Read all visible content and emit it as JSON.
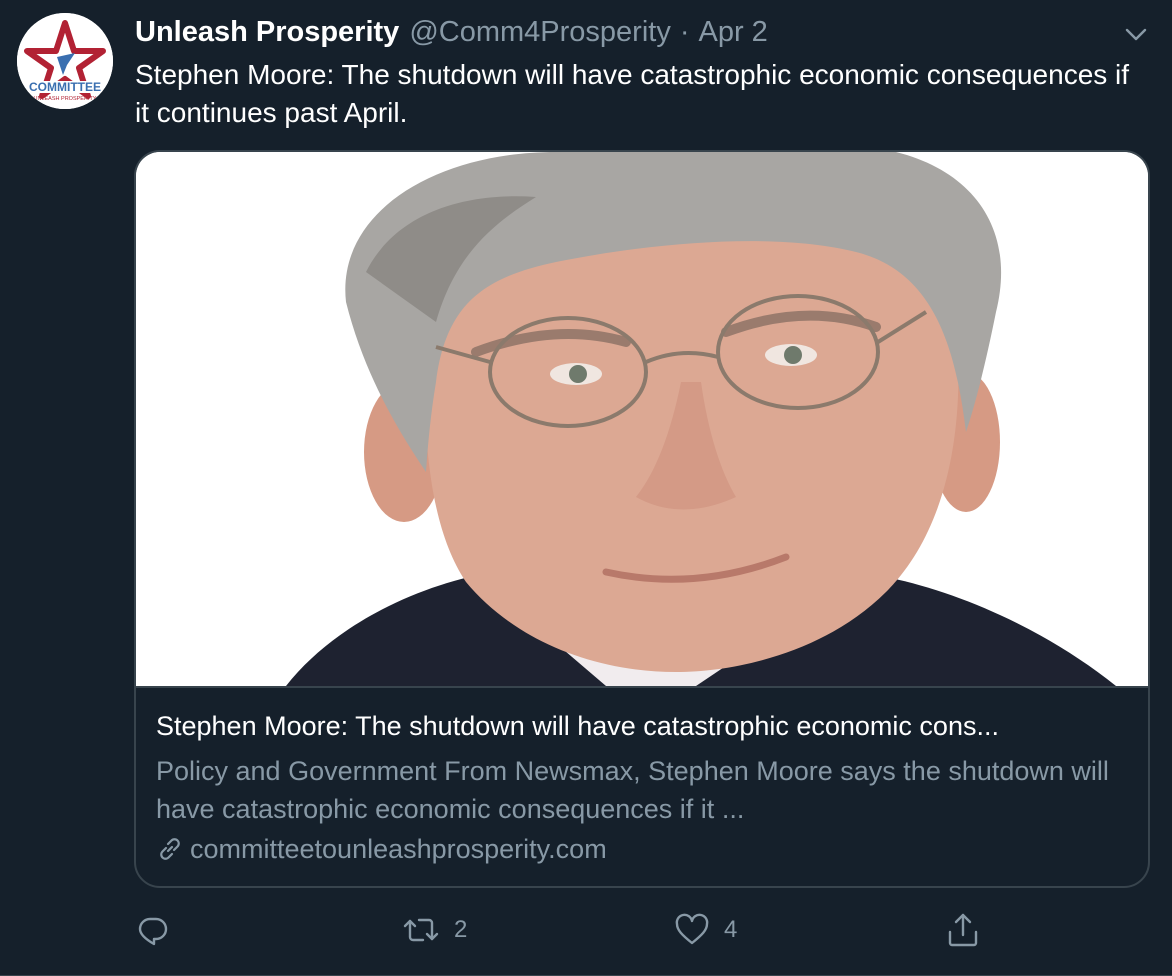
{
  "tweet": {
    "display_name": "Unleash Prosperity",
    "handle": "@Comm4Prosperity",
    "separator": "·",
    "date": "Apr 2",
    "text": "Stephen Moore: The shutdown will have catastrophic economic consequences if it continues past April.",
    "avatar": {
      "logo_text": "COMMITTEE",
      "logo_subtext": "UNLEASH PROSPERITY",
      "colors": {
        "star": "#b22234",
        "text": "#3a6fb0"
      }
    },
    "more_icon": "chevron-down-icon"
  },
  "card": {
    "title": "Stephen Moore: The shutdown will have catastrophic economic cons...",
    "description": "Policy and Government From Newsmax, Stephen Moore says the shutdown will have catastrophic economic consequences if it ...",
    "domain": "committeetounleashprosperity.com",
    "link_icon": "link-icon",
    "image_subject": "portrait-photo"
  },
  "actions": {
    "reply": {
      "icon": "reply-icon",
      "count": ""
    },
    "retweet": {
      "icon": "retweet-icon",
      "count": "2"
    },
    "like": {
      "icon": "heart-icon",
      "count": "4"
    },
    "share": {
      "icon": "share-icon",
      "count": ""
    }
  },
  "colors": {
    "background": "#15202b",
    "border": "#38444d",
    "secondary_text": "#8899a6",
    "primary_text": "#ffffff"
  }
}
